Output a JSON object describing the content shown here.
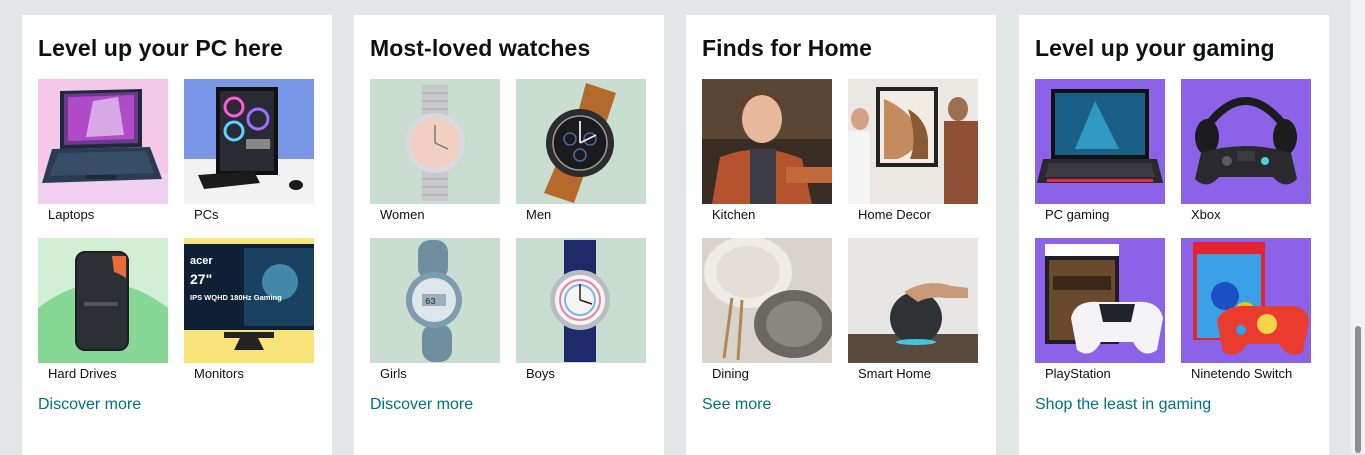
{
  "cards": [
    {
      "title": "Level up your PC here",
      "link": "Discover more",
      "tiles": [
        {
          "label": "Laptops",
          "icon": "laptop-icon",
          "bg": "#f5c8e8"
        },
        {
          "label": "PCs",
          "icon": "desktop-pc-icon",
          "bg": "#7a96e6"
        },
        {
          "label": "Hard Drives",
          "icon": "hard-drive-icon",
          "bg": "#9fe0a8"
        },
        {
          "label": "Monitors",
          "icon": "monitor-icon",
          "bg": "#f8e27a",
          "screen_text": [
            "acer",
            "27\"",
            "IPS WQHD 180Hz Gaming"
          ]
        }
      ]
    },
    {
      "title": "Most-loved watches",
      "link": "Discover more",
      "tiles": [
        {
          "label": "Women",
          "icon": "womens-watch-icon",
          "bg": "#c9ddd0"
        },
        {
          "label": "Men",
          "icon": "mens-watch-icon",
          "bg": "#c9ddd0"
        },
        {
          "label": "Girls",
          "icon": "girls-watch-icon",
          "bg": "#c9ddd0"
        },
        {
          "label": "Boys",
          "icon": "boys-watch-icon",
          "bg": "#c9ddd0"
        }
      ]
    },
    {
      "title": "Finds for Home",
      "link": "See more",
      "tiles": [
        {
          "label": "Kitchen",
          "icon": "kitchen-icon",
          "bg": "#3a2e24"
        },
        {
          "label": "Home Decor",
          "icon": "wall-art-icon",
          "bg": "#e9e6e2"
        },
        {
          "label": "Dining",
          "icon": "dining-plates-icon",
          "bg": "#d8d3cc"
        },
        {
          "label": "Smart Home",
          "icon": "smart-speaker-icon",
          "bg": "#e8e6e4"
        }
      ]
    },
    {
      "title": "Level up your gaming",
      "link": "Shop the least in gaming",
      "tiles": [
        {
          "label": "PC gaming",
          "icon": "gaming-laptop-icon",
          "bg": "#8c63e8"
        },
        {
          "label": "Xbox",
          "icon": "xbox-controller-headset-icon",
          "bg": "#8c63e8"
        },
        {
          "label": "PlayStation",
          "icon": "playstation-bundle-icon",
          "bg": "#8c63e8"
        },
        {
          "label": "Ninetendo Switch",
          "icon": "switch-bundle-icon",
          "bg": "#8c63e8"
        }
      ]
    }
  ],
  "colors": {
    "link": "#007185",
    "page_bg": "#e3e6e6",
    "card_bg": "#ffffff"
  }
}
